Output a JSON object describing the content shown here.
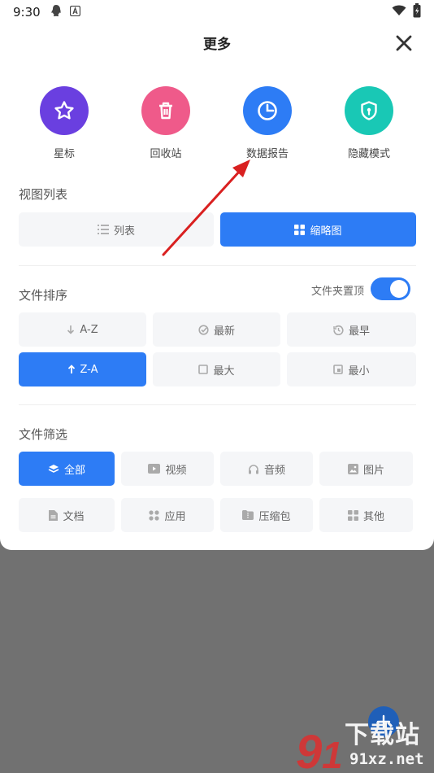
{
  "status": {
    "time": "9:30"
  },
  "sheet": {
    "title": "更多"
  },
  "quick_actions": [
    {
      "label": "星标",
      "color": "#6a3fe0"
    },
    {
      "label": "回收站",
      "color": "#ef5a8a"
    },
    {
      "label": "数据报告",
      "color": "#2d7cf5"
    },
    {
      "label": "隐藏模式",
      "color": "#19c8b5"
    }
  ],
  "view_list": {
    "label": "视图列表",
    "options": [
      "列表",
      "缩略图"
    ],
    "selected": "缩略图"
  },
  "sort": {
    "label": "文件排序",
    "folder_top_label": "文件夹置顶",
    "folder_top_on": true,
    "options": [
      "A-Z",
      "最新",
      "最早",
      "Z-A",
      "最大",
      "最小"
    ],
    "selected": "Z-A"
  },
  "filter": {
    "label": "文件筛选",
    "options": [
      "全部",
      "视频",
      "音频",
      "图片",
      "文档",
      "应用",
      "压缩包",
      "其他"
    ],
    "selected": "全部"
  },
  "watermark": {
    "text": "下载站",
    "site": "91xz.net"
  },
  "colors": {
    "accent": "#2d7cf5",
    "overlay": "#717171"
  }
}
